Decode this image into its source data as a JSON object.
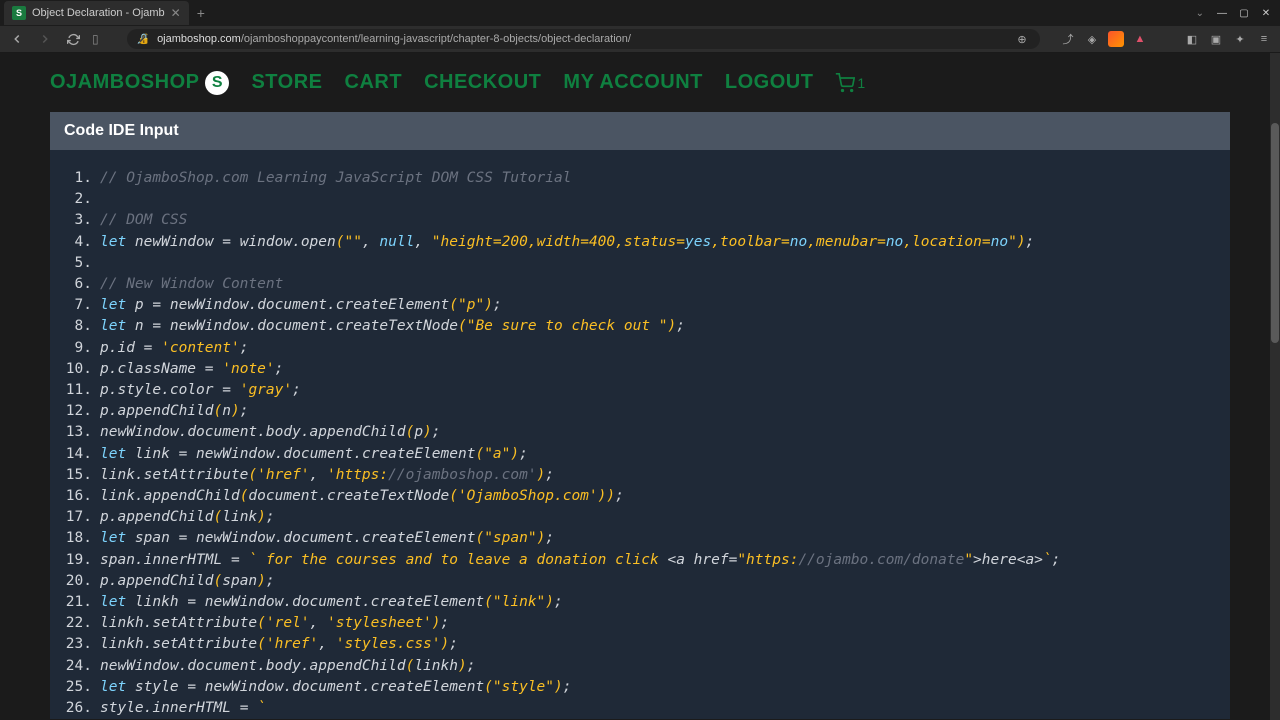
{
  "browser": {
    "tab": {
      "title": "Object Declaration - Ojamb",
      "favicon_letter": "S"
    },
    "url": {
      "domain": "ojamboshop.com",
      "path": "/ojamboshoppaycontent/learning-javascript/chapter-8-objects/object-declaration/"
    },
    "window": {
      "chevron": "⌄",
      "min": "—",
      "max": "▢",
      "close": "✕"
    }
  },
  "header": {
    "logo": "OJAMBOSHOP",
    "logo_badge": "S",
    "nav": [
      "STORE",
      "CART",
      "CHECKOUT",
      "MY ACCOUNT",
      "LOGOUT"
    ],
    "cart_count": "1"
  },
  "ide": {
    "title": "Code IDE Input",
    "lines": [
      {
        "n": "1.",
        "tokens": [
          [
            "comment",
            "// OjamboShop.com Learning JavaScript DOM CSS Tutorial"
          ]
        ]
      },
      {
        "n": "2.",
        "tokens": []
      },
      {
        "n": "3.",
        "tokens": [
          [
            "comment",
            "// DOM CSS"
          ]
        ]
      },
      {
        "n": "4.",
        "tokens": [
          [
            "keyword",
            "let"
          ],
          [
            "ident",
            " newWindow "
          ],
          [
            "punct",
            "="
          ],
          [
            "ident",
            " window"
          ],
          [
            "punct",
            "."
          ],
          [
            "ident",
            "open"
          ],
          [
            "paren",
            "("
          ],
          [
            "string",
            "\"\""
          ],
          [
            "punct",
            ","
          ],
          [
            "ident",
            " "
          ],
          [
            "keyword",
            "null"
          ],
          [
            "punct",
            ","
          ],
          [
            "ident",
            " "
          ],
          [
            "string",
            "\"height="
          ],
          [
            "number",
            "200"
          ],
          [
            "string",
            ",width="
          ],
          [
            "number",
            "400"
          ],
          [
            "string",
            ",status="
          ],
          [
            "keyword",
            "yes"
          ],
          [
            "string",
            ",toolbar="
          ],
          [
            "keyword",
            "no"
          ],
          [
            "string",
            ",menubar="
          ],
          [
            "keyword",
            "no"
          ],
          [
            "string",
            ",location="
          ],
          [
            "keyword",
            "no"
          ],
          [
            "string",
            "\""
          ],
          [
            "paren",
            ")"
          ],
          [
            "punct",
            ";"
          ]
        ]
      },
      {
        "n": "5.",
        "tokens": []
      },
      {
        "n": "6.",
        "tokens": [
          [
            "comment",
            "// New Window Content"
          ]
        ]
      },
      {
        "n": "7.",
        "tokens": [
          [
            "keyword",
            "let"
          ],
          [
            "ident",
            " p "
          ],
          [
            "punct",
            "="
          ],
          [
            "ident",
            " newWindow"
          ],
          [
            "punct",
            "."
          ],
          [
            "ident",
            "document"
          ],
          [
            "punct",
            "."
          ],
          [
            "ident",
            "createElement"
          ],
          [
            "paren",
            "("
          ],
          [
            "string",
            "\"p\""
          ],
          [
            "paren",
            ")"
          ],
          [
            "punct",
            ";"
          ]
        ]
      },
      {
        "n": "8.",
        "tokens": [
          [
            "keyword",
            "let"
          ],
          [
            "ident",
            " n "
          ],
          [
            "punct",
            "="
          ],
          [
            "ident",
            " newWindow"
          ],
          [
            "punct",
            "."
          ],
          [
            "ident",
            "document"
          ],
          [
            "punct",
            "."
          ],
          [
            "ident",
            "createTextNode"
          ],
          [
            "paren",
            "("
          ],
          [
            "string",
            "\"Be sure to check out \""
          ],
          [
            "paren",
            ")"
          ],
          [
            "punct",
            ";"
          ]
        ]
      },
      {
        "n": "9.",
        "tokens": [
          [
            "ident",
            "p"
          ],
          [
            "punct",
            "."
          ],
          [
            "ident",
            "id "
          ],
          [
            "punct",
            "="
          ],
          [
            "ident",
            " "
          ],
          [
            "string",
            "'content'"
          ],
          [
            "punct",
            ";"
          ]
        ]
      },
      {
        "n": "10.",
        "tokens": [
          [
            "ident",
            "p"
          ],
          [
            "punct",
            "."
          ],
          [
            "ident",
            "className "
          ],
          [
            "punct",
            "="
          ],
          [
            "ident",
            " "
          ],
          [
            "string",
            "'note'"
          ],
          [
            "punct",
            ";"
          ]
        ]
      },
      {
        "n": "11.",
        "tokens": [
          [
            "ident",
            "p"
          ],
          [
            "punct",
            "."
          ],
          [
            "ident",
            "style"
          ],
          [
            "punct",
            "."
          ],
          [
            "ident",
            "color "
          ],
          [
            "punct",
            "="
          ],
          [
            "ident",
            " "
          ],
          [
            "string",
            "'gray'"
          ],
          [
            "punct",
            ";"
          ]
        ]
      },
      {
        "n": "12.",
        "tokens": [
          [
            "ident",
            "p"
          ],
          [
            "punct",
            "."
          ],
          [
            "ident",
            "appendChild"
          ],
          [
            "paren",
            "("
          ],
          [
            "ident",
            "n"
          ],
          [
            "paren",
            ")"
          ],
          [
            "punct",
            ";"
          ]
        ]
      },
      {
        "n": "13.",
        "tokens": [
          [
            "ident",
            "newWindow"
          ],
          [
            "punct",
            "."
          ],
          [
            "ident",
            "document"
          ],
          [
            "punct",
            "."
          ],
          [
            "ident",
            "body"
          ],
          [
            "punct",
            "."
          ],
          [
            "ident",
            "appendChild"
          ],
          [
            "paren",
            "("
          ],
          [
            "ident",
            "p"
          ],
          [
            "paren",
            ")"
          ],
          [
            "punct",
            ";"
          ]
        ]
      },
      {
        "n": "14.",
        "tokens": [
          [
            "keyword",
            "let"
          ],
          [
            "ident",
            " link "
          ],
          [
            "punct",
            "="
          ],
          [
            "ident",
            " newWindow"
          ],
          [
            "punct",
            "."
          ],
          [
            "ident",
            "document"
          ],
          [
            "punct",
            "."
          ],
          [
            "ident",
            "createElement"
          ],
          [
            "paren",
            "("
          ],
          [
            "string",
            "\"a\""
          ],
          [
            "paren",
            ")"
          ],
          [
            "punct",
            ";"
          ]
        ]
      },
      {
        "n": "15.",
        "tokens": [
          [
            "ident",
            "link"
          ],
          [
            "punct",
            "."
          ],
          [
            "ident",
            "setAttribute"
          ],
          [
            "paren",
            "("
          ],
          [
            "string",
            "'href'"
          ],
          [
            "punct",
            ","
          ],
          [
            "ident",
            " "
          ],
          [
            "string",
            "'https:"
          ],
          [
            "url",
            "//ojamboshop.com'"
          ],
          [
            "paren",
            ")"
          ],
          [
            "punct",
            ";"
          ]
        ]
      },
      {
        "n": "16.",
        "tokens": [
          [
            "ident",
            "link"
          ],
          [
            "punct",
            "."
          ],
          [
            "ident",
            "appendChild"
          ],
          [
            "paren",
            "("
          ],
          [
            "ident",
            "document"
          ],
          [
            "punct",
            "."
          ],
          [
            "ident",
            "createTextNode"
          ],
          [
            "paren",
            "("
          ],
          [
            "string",
            "'OjamboShop.com'"
          ],
          [
            "paren",
            "))"
          ],
          [
            "punct",
            ";"
          ]
        ]
      },
      {
        "n": "17.",
        "tokens": [
          [
            "ident",
            "p"
          ],
          [
            "punct",
            "."
          ],
          [
            "ident",
            "appendChild"
          ],
          [
            "paren",
            "("
          ],
          [
            "ident",
            "link"
          ],
          [
            "paren",
            ")"
          ],
          [
            "punct",
            ";"
          ]
        ]
      },
      {
        "n": "18.",
        "tokens": [
          [
            "keyword",
            "let"
          ],
          [
            "ident",
            " span "
          ],
          [
            "punct",
            "="
          ],
          [
            "ident",
            " newWindow"
          ],
          [
            "punct",
            "."
          ],
          [
            "ident",
            "document"
          ],
          [
            "punct",
            "."
          ],
          [
            "ident",
            "createElement"
          ],
          [
            "paren",
            "("
          ],
          [
            "string",
            "\"span\""
          ],
          [
            "paren",
            ")"
          ],
          [
            "punct",
            ";"
          ]
        ]
      },
      {
        "n": "19.",
        "tokens": [
          [
            "ident",
            "span"
          ],
          [
            "punct",
            "."
          ],
          [
            "ident",
            "innerHTML "
          ],
          [
            "punct",
            "="
          ],
          [
            "ident",
            " "
          ],
          [
            "string",
            "` for the courses and to leave a donation click "
          ],
          [
            "punct",
            "<"
          ],
          [
            "ident",
            "a href"
          ],
          [
            "punct",
            "="
          ],
          [
            "string",
            "\"https:"
          ],
          [
            "url",
            "//ojambo.com/donate"
          ],
          [
            "string",
            "\""
          ],
          [
            "punct",
            ">"
          ],
          [
            "ident",
            "here"
          ],
          [
            "punct",
            "<"
          ],
          [
            "ident",
            "a"
          ],
          [
            "punct",
            ">"
          ],
          [
            "string",
            "`"
          ],
          [
            "punct",
            ";"
          ]
        ]
      },
      {
        "n": "20.",
        "tokens": [
          [
            "ident",
            "p"
          ],
          [
            "punct",
            "."
          ],
          [
            "ident",
            "appendChild"
          ],
          [
            "paren",
            "("
          ],
          [
            "ident",
            "span"
          ],
          [
            "paren",
            ")"
          ],
          [
            "punct",
            ";"
          ]
        ]
      },
      {
        "n": "21.",
        "tokens": [
          [
            "keyword",
            "let"
          ],
          [
            "ident",
            " linkh "
          ],
          [
            "punct",
            "="
          ],
          [
            "ident",
            " newWindow"
          ],
          [
            "punct",
            "."
          ],
          [
            "ident",
            "document"
          ],
          [
            "punct",
            "."
          ],
          [
            "ident",
            "createElement"
          ],
          [
            "paren",
            "("
          ],
          [
            "string",
            "\"link\""
          ],
          [
            "paren",
            ")"
          ],
          [
            "punct",
            ";"
          ]
        ]
      },
      {
        "n": "22.",
        "tokens": [
          [
            "ident",
            "linkh"
          ],
          [
            "punct",
            "."
          ],
          [
            "ident",
            "setAttribute"
          ],
          [
            "paren",
            "("
          ],
          [
            "string",
            "'rel'"
          ],
          [
            "punct",
            ","
          ],
          [
            "ident",
            " "
          ],
          [
            "string",
            "'stylesheet'"
          ],
          [
            "paren",
            ")"
          ],
          [
            "punct",
            ";"
          ]
        ]
      },
      {
        "n": "23.",
        "tokens": [
          [
            "ident",
            "linkh"
          ],
          [
            "punct",
            "."
          ],
          [
            "ident",
            "setAttribute"
          ],
          [
            "paren",
            "("
          ],
          [
            "string",
            "'href'"
          ],
          [
            "punct",
            ","
          ],
          [
            "ident",
            " "
          ],
          [
            "string",
            "'styles.css'"
          ],
          [
            "paren",
            ")"
          ],
          [
            "punct",
            ";"
          ]
        ]
      },
      {
        "n": "24.",
        "tokens": [
          [
            "ident",
            "newWindow"
          ],
          [
            "punct",
            "."
          ],
          [
            "ident",
            "document"
          ],
          [
            "punct",
            "."
          ],
          [
            "ident",
            "body"
          ],
          [
            "punct",
            "."
          ],
          [
            "ident",
            "appendChild"
          ],
          [
            "paren",
            "("
          ],
          [
            "ident",
            "linkh"
          ],
          [
            "paren",
            ")"
          ],
          [
            "punct",
            ";"
          ]
        ]
      },
      {
        "n": "25.",
        "tokens": [
          [
            "keyword",
            "let"
          ],
          [
            "ident",
            " style "
          ],
          [
            "punct",
            "="
          ],
          [
            "ident",
            " newWindow"
          ],
          [
            "punct",
            "."
          ],
          [
            "ident",
            "document"
          ],
          [
            "punct",
            "."
          ],
          [
            "ident",
            "createElement"
          ],
          [
            "paren",
            "("
          ],
          [
            "string",
            "\"style\""
          ],
          [
            "paren",
            ")"
          ],
          [
            "punct",
            ";"
          ]
        ]
      },
      {
        "n": "26.",
        "tokens": [
          [
            "ident",
            "style"
          ],
          [
            "punct",
            "."
          ],
          [
            "ident",
            "innerHTML "
          ],
          [
            "punct",
            "="
          ],
          [
            "ident",
            " "
          ],
          [
            "string",
            "`"
          ]
        ]
      }
    ]
  }
}
